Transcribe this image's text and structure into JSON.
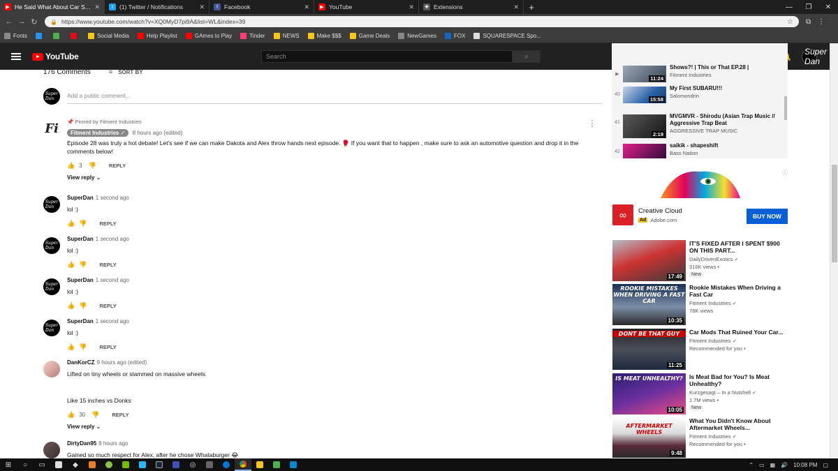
{
  "browser": {
    "tabs": [
      {
        "title": "He Said What About Car Shows?!",
        "icon": "youtube-icon",
        "color": "#ff0000",
        "active": true
      },
      {
        "title": "(1) Twitter / Notifications",
        "icon": "twitter-icon",
        "color": "#1da1f2",
        "active": false
      },
      {
        "title": "Facebook",
        "icon": "facebook-icon",
        "color": "#3b5998",
        "active": false
      },
      {
        "title": "YouTube",
        "icon": "youtube-icon",
        "color": "#ff0000",
        "active": false
      },
      {
        "title": "Extensions",
        "icon": "puzzle-icon",
        "color": "#777777",
        "active": false
      }
    ],
    "url": "https://www.youtube.com/watch?v=XQ0MyD7pi9A&list=WL&index=39",
    "bookmarks": [
      {
        "label": "Fonts",
        "color": "#888888"
      },
      {
        "label": "",
        "color": "#2196f3"
      },
      {
        "label": "",
        "color": "#4caf50"
      },
      {
        "label": "",
        "color": "#e50914"
      },
      {
        "label": "Social Media",
        "color": "#f5c518"
      },
      {
        "label": "Help Playlist",
        "color": "#ff0000"
      },
      {
        "label": "GAmes to Play",
        "color": "#ff0000"
      },
      {
        "label": "Tinder",
        "color": "#fe3c72"
      },
      {
        "label": "NEWS",
        "color": "#f5c518"
      },
      {
        "label": "Make $$$",
        "color": "#f5c518"
      },
      {
        "label": "Game Deals",
        "color": "#f5c518"
      },
      {
        "label": "NewGames",
        "color": "#888888"
      },
      {
        "label": "FOX",
        "color": "#1565c0"
      },
      {
        "label": "SQUARESPACE Spo...",
        "color": "#dddddd"
      }
    ]
  },
  "youtube": {
    "logo": "YouTube",
    "search_placeholder": "Search",
    "avatar": "Super Dan"
  },
  "comments": {
    "count_label": "176 Comments",
    "sort_label": "SORT BY",
    "add_placeholder": "Add a public comment...",
    "items": [
      {
        "pinned": "Pinned by Fitment Industries",
        "author": "Fitment Industries",
        "time": "8 hours ago (edited)",
        "text": "Episode 28 was truly a hot debate! Let's see if we can make Dakota and Alex throw hands next episode. 🥊 If you want that to happen , make sure to ask an automotive question and drop it in the comments below!",
        "likes": "3",
        "reply": "REPLY",
        "view_reply": "View reply"
      },
      {
        "author": "SuperDan",
        "time": "1 second ago",
        "text": "lol :)",
        "reply": "REPLY"
      },
      {
        "author": "SuperDan",
        "time": "1 second ago",
        "text": "lol :)",
        "reply": "REPLY"
      },
      {
        "author": "SuperDan",
        "time": "1 second ago",
        "text": "lol :)",
        "reply": "REPLY"
      },
      {
        "author": "SuperDan",
        "time": "1 second ago",
        "text": "lol :)",
        "reply": "REPLY"
      },
      {
        "author": "DanKorCZ",
        "time": "9 hours ago (edited)",
        "text1": "Lifted on tiny wheels or slammed on massive wheels",
        "text2": "Like 15 inches vs Donks",
        "likes": "30",
        "reply": "REPLY",
        "view_reply": "View reply"
      },
      {
        "author": "DirtyDan95",
        "time": "8 hours ago",
        "text": "Gained so much respect for Alex, after he chose Whataburger 😂"
      }
    ]
  },
  "playlist": [
    {
      "index": "",
      "title": "Shows?! | This or That EP.28 |",
      "channel": "Fitment Industries",
      "duration": "11:24"
    },
    {
      "index": "40",
      "title": "My First SUBARU!!!",
      "channel": "Salomondrin",
      "duration": "15:58"
    },
    {
      "index": "41",
      "title": "MVGMVR - Shirodu (Asian Trap Music // Aggressive Trap Beat",
      "channel": "AGGRESSIVE TRAP MUSIC",
      "duration": "2:19"
    },
    {
      "index": "42",
      "title": "saikik - shapeshift",
      "channel": "Bass Nation",
      "duration": ""
    }
  ],
  "ad": {
    "title": "Creative Cloud",
    "badge": "Ad",
    "domain": "Adobe.com",
    "cta": "BUY NOW"
  },
  "recommended": [
    {
      "title": "IT'S FIXED AFTER I SPENT $900 ON THIS PART...",
      "channel": "DailyDrivenExotics",
      "views": "316K views •",
      "extra": "New",
      "duration": "17:49",
      "caption": ""
    },
    {
      "title": "Rookie Mistakes When Driving a Fast Car",
      "channel": "Fitment Industries",
      "views": "78K views",
      "extra": "",
      "duration": "10:35",
      "caption": "ROOKIE MISTAKES WHEN DRIVING A FAST CAR"
    },
    {
      "title": "Car Mods That Ruined Your Car...",
      "channel": "Fitment Industries",
      "views": "Recommended for you •",
      "extra": "",
      "duration": "11:25",
      "caption": "DONT BE THAT GUY"
    },
    {
      "title": "Is Meat Bad for You? Is Meat Unhealthy?",
      "channel": "Kurzgesagt – In a Nutshell",
      "views": "1.7M views •",
      "extra": "New",
      "duration": "10:05",
      "caption": "IS MEAT UNHEALTHY?"
    },
    {
      "title": "What You Didn't Know About Aftermarket Wheels...",
      "channel": "Fitment Industries",
      "views": "Recommended for you •",
      "extra": "",
      "duration": "9:48",
      "caption": "AFTERMARKET WHEELS"
    }
  ],
  "taskbar": {
    "time": "10:08 PM"
  }
}
